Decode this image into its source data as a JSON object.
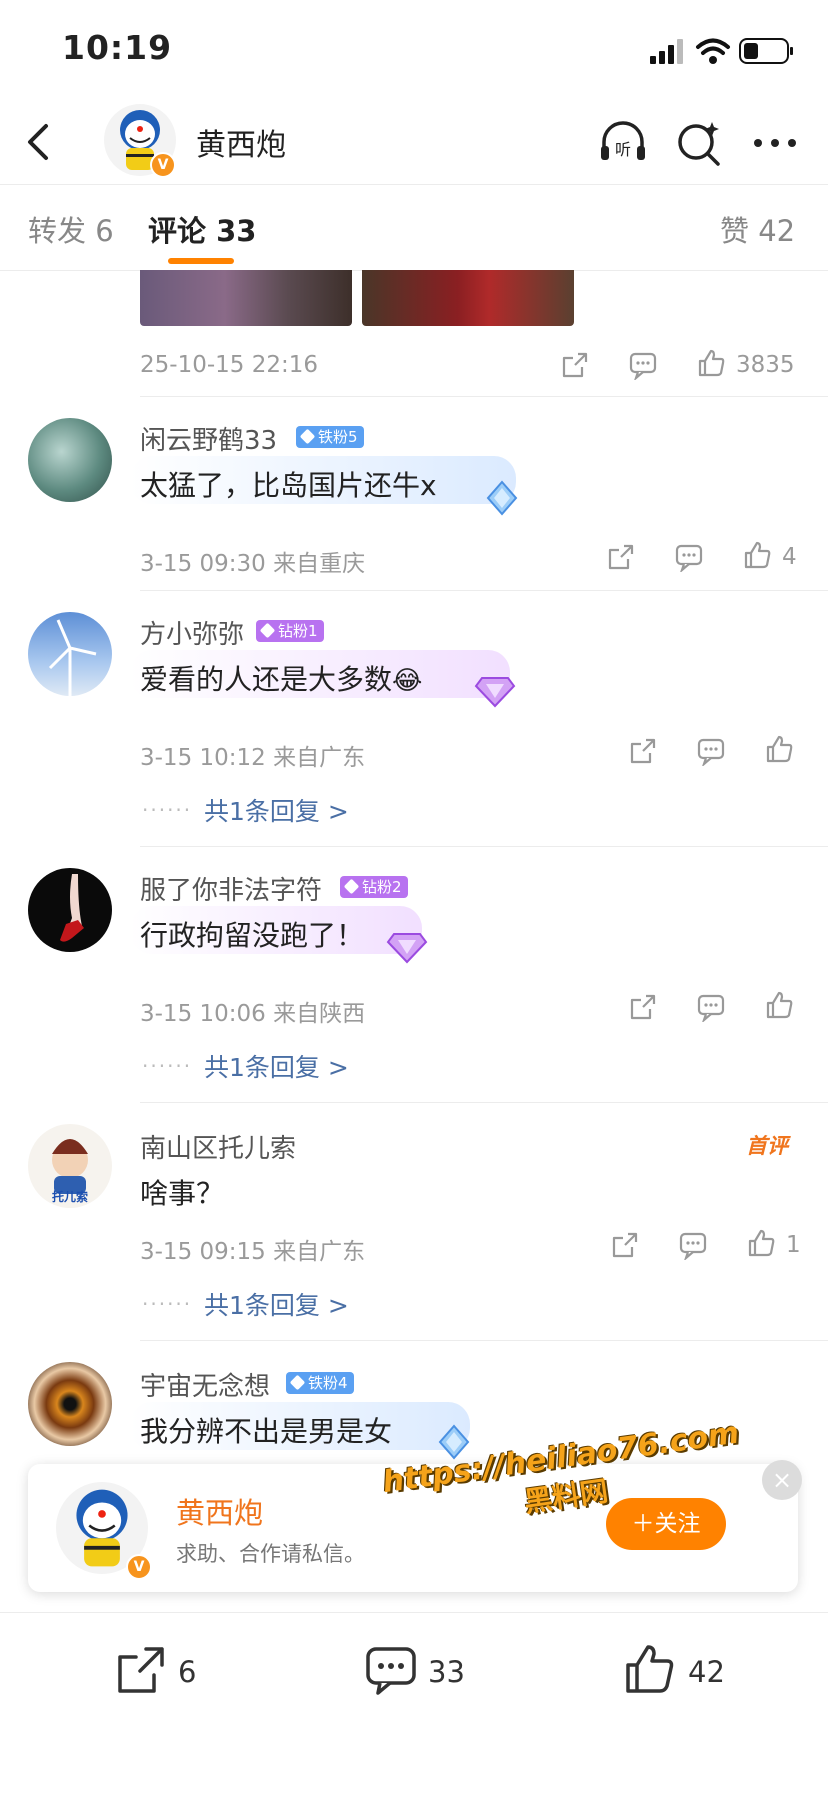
{
  "status_bar": {
    "time": "10:19"
  },
  "nav": {
    "username": "黄西炮",
    "verified": "V"
  },
  "tabs": {
    "repost": "转发 6",
    "comment": "评论 33",
    "like": "赞 42"
  },
  "post_footer": {
    "date": "25-10-15 22:16",
    "likes": "3835"
  },
  "comments": [
    {
      "name": "闲云野鹤33",
      "badge": "铁粉5",
      "text": "太猛了，比岛国片还牛x",
      "meta": "3-15 09:30 来自重庆",
      "likes": "4"
    },
    {
      "name": "方小弥弥",
      "badge": "钻粉1",
      "text": "爱看的人还是大多数",
      "emoji": "😂",
      "meta": "3-15 10:12 来自广东",
      "likes": "",
      "replies": "共1条回复 >"
    },
    {
      "name": "服了你非法字符",
      "badge": "钻粉2",
      "text": "行政拘留没跑了！",
      "meta": "3-15 10:06 来自陕西",
      "likes": "",
      "replies": "共1条回复 >"
    },
    {
      "name": "南山区托儿索",
      "first": "首评",
      "text": "啥事？",
      "meta": "3-15 09:15 来自广东",
      "likes": "1",
      "replies": "共1条回复 >",
      "avatar_text": "托儿索"
    },
    {
      "name": "宇宙无念想",
      "badge": "铁粉4",
      "text": "我分辨不出是男是女"
    }
  ],
  "dots": "······",
  "card": {
    "name": "黄西炮",
    "desc": "求助、合作请私信。",
    "follow": "＋关注",
    "close": "×",
    "verified": "V"
  },
  "watermark": {
    "url": "https://heiliao76.com",
    "text": "黑料网"
  },
  "bottom_bar": {
    "reposts": "6",
    "comments": "33",
    "likes": "42"
  },
  "colors": {
    "accent": "#ff8200",
    "reply_link": "#4a6fa5",
    "iron_badge": "#5aa0f2",
    "diamond_badge": "#b872f0"
  }
}
